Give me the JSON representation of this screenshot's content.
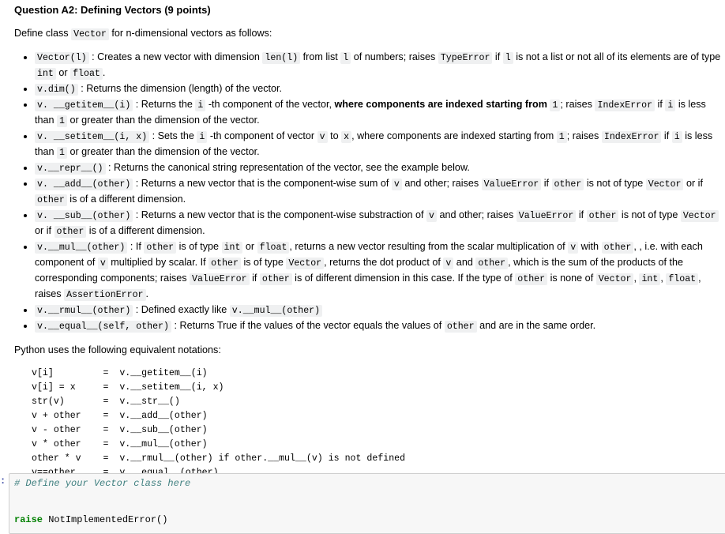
{
  "title": "Question A2: Defining Vectors (9 points)",
  "intro": [
    {
      "t": "Define class "
    },
    {
      "c": "Vector"
    },
    {
      "t": " for n-dimensional vectors as follows:"
    }
  ],
  "bullets": [
    [
      {
        "c": "Vector(l)"
      },
      {
        "t": " : Creates a new vector with dimension "
      },
      {
        "c": "len(l)"
      },
      {
        "t": " from list "
      },
      {
        "c": "l"
      },
      {
        "t": " of numbers; raises "
      },
      {
        "c": "TypeError"
      },
      {
        "t": " if "
      },
      {
        "c": "l"
      },
      {
        "t": " is not a list or not all of its elements are of type "
      },
      {
        "c": "int"
      },
      {
        "t": " or "
      },
      {
        "c": "float"
      },
      {
        "t": "."
      }
    ],
    [
      {
        "c": "v.dim()"
      },
      {
        "t": " : Returns the dimension (length) of the vector."
      }
    ],
    [
      {
        "c": "v. __getitem__(i)"
      },
      {
        "t": " : Returns the "
      },
      {
        "c": "i"
      },
      {
        "t": " -th component of the vector, "
      },
      {
        "b": "where components are indexed starting from "
      },
      {
        "c": "1"
      },
      {
        "t": "; raises "
      },
      {
        "c": "IndexError"
      },
      {
        "t": " if "
      },
      {
        "c": "i"
      },
      {
        "t": " is less than "
      },
      {
        "c": "1"
      },
      {
        "t": " or greater than the dimension of the vector."
      }
    ],
    [
      {
        "c": "v. __setitem__(i, x)"
      },
      {
        "t": " : Sets the "
      },
      {
        "c": "i"
      },
      {
        "t": " -th component of vector "
      },
      {
        "c": "v"
      },
      {
        "t": " to "
      },
      {
        "c": "x"
      },
      {
        "t": ", where components are indexed starting from "
      },
      {
        "c": "1"
      },
      {
        "t": "; raises "
      },
      {
        "c": "IndexError"
      },
      {
        "t": " if "
      },
      {
        "c": "i"
      },
      {
        "t": " is less than "
      },
      {
        "c": "1"
      },
      {
        "t": " or greater than the dimension of the vector."
      }
    ],
    [
      {
        "c": "v.__repr__()"
      },
      {
        "t": " : Returns the canonical string representation of the vector, see the example below."
      }
    ],
    [
      {
        "c": "v. __add__(other)"
      },
      {
        "t": " : Returns a new vector that is the component-wise sum of "
      },
      {
        "c": "v"
      },
      {
        "t": " and other; raises "
      },
      {
        "c": "ValueError"
      },
      {
        "t": " if "
      },
      {
        "c": "other"
      },
      {
        "t": " is not of type "
      },
      {
        "c": "Vector"
      },
      {
        "t": " or if "
      },
      {
        "c": "other"
      },
      {
        "t": " is of a different dimension."
      }
    ],
    [
      {
        "c": "v. __sub__(other)"
      },
      {
        "t": " : Returns a new vector that is the component-wise substraction of "
      },
      {
        "c": "v"
      },
      {
        "t": " and other; raises "
      },
      {
        "c": "ValueError"
      },
      {
        "t": " if "
      },
      {
        "c": "other"
      },
      {
        "t": " is not of type "
      },
      {
        "c": "Vector"
      },
      {
        "t": " or if "
      },
      {
        "c": "other"
      },
      {
        "t": " is of a different dimension."
      }
    ],
    [
      {
        "c": "v.__mul__(other)"
      },
      {
        "t": " : If "
      },
      {
        "c": "other"
      },
      {
        "t": " is of type "
      },
      {
        "c": "int"
      },
      {
        "t": " or "
      },
      {
        "c": "float"
      },
      {
        "t": ", returns a new vector resulting from the scalar multiplication of "
      },
      {
        "c": "v"
      },
      {
        "t": " with "
      },
      {
        "c": "other"
      },
      {
        "t": ", , i.e. with each component of "
      },
      {
        "c": "v"
      },
      {
        "t": " multiplied by scalar. If "
      },
      {
        "c": "other"
      },
      {
        "t": " is of type "
      },
      {
        "c": "Vector"
      },
      {
        "t": ", returns the dot product of "
      },
      {
        "c": "v"
      },
      {
        "t": " and "
      },
      {
        "c": "other"
      },
      {
        "t": ", which is the sum of the products of the corresponding components; raises "
      },
      {
        "c": "ValueError"
      },
      {
        "t": " if "
      },
      {
        "c": "other"
      },
      {
        "t": " is of different dimension in this case. If the type of "
      },
      {
        "c": "other"
      },
      {
        "t": " is none of "
      },
      {
        "c": "Vector"
      },
      {
        "t": ", "
      },
      {
        "c": "int"
      },
      {
        "t": ", "
      },
      {
        "c": "float"
      },
      {
        "t": ", raises "
      },
      {
        "c": "AssertionError"
      },
      {
        "t": "."
      }
    ],
    [
      {
        "c": "v.__rmul__(other)"
      },
      {
        "t": " : Defined exactly like "
      },
      {
        "c": "v.__mul__(other)"
      }
    ],
    [
      {
        "c": "v.__equal__(self, other)"
      },
      {
        "t": " : Returns True if the values of the vector equals the values of "
      },
      {
        "c": "other"
      },
      {
        "t": " and are in the same order."
      }
    ]
  ],
  "notation_intro": "Python uses the following equivalent notations:",
  "notations": "v[i]         =  v.__getitem__(i)\nv[i] = x     =  v.__setitem__(i, x)\nstr(v)       =  v.__str__()\nv + other    =  v.__add__(other)\nv - other    =  v.__sub__(other)\nv * other    =  v.__mul__(other)\nother * v    =  v.__rmul__(other) if other.__mul__(v) is not defined\nv==other     =  v.__equal__(other)",
  "cell": {
    "prompt": ":",
    "comment": "# Define your Vector class here",
    "keyword": "raise",
    "rest": " NotImplementedError()"
  }
}
